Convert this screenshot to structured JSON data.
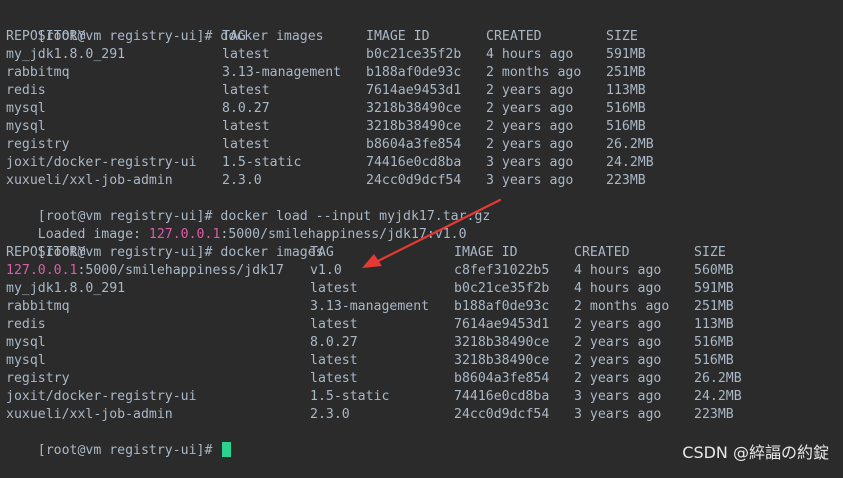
{
  "terminal": {
    "prompt": "[root@vm registry-ui]# ",
    "cmd1": "docker images",
    "cmd2": "docker load --input myjdk17.tar.gz",
    "loaded_prefix": "Loaded image: ",
    "loaded_ip": "127.0.0.1",
    "loaded_rest": ":5000/smilehappiness/jdk17:v1.0",
    "cmd3": "docker images"
  },
  "table1": {
    "headers": [
      "REPOSITORY",
      "TAG",
      "IMAGE ID",
      "CREATED",
      "SIZE"
    ],
    "rows": [
      [
        "my_jdk1.8.0_291",
        "latest",
        "b0c21ce35f2b",
        "4 hours ago",
        "591MB"
      ],
      [
        "rabbitmq",
        "3.13-management",
        "b188af0de93c",
        "2 months ago",
        "251MB"
      ],
      [
        "redis",
        "latest",
        "7614ae9453d1",
        "2 years ago",
        "113MB"
      ],
      [
        "mysql",
        "8.0.27",
        "3218b38490ce",
        "2 years ago",
        "516MB"
      ],
      [
        "mysql",
        "latest",
        "3218b38490ce",
        "2 years ago",
        "516MB"
      ],
      [
        "registry",
        "latest",
        "b8604a3fe854",
        "2 years ago",
        "26.2MB"
      ],
      [
        "joxit/docker-registry-ui",
        "1.5-static",
        "74416e0cd8ba",
        "3 years ago",
        "24.2MB"
      ],
      [
        "xuxueli/xxl-job-admin",
        "2.3.0",
        "24cc0d9dcf54",
        "3 years ago",
        "223MB"
      ]
    ]
  },
  "table2": {
    "headers": [
      "REPOSITORY",
      "TAG",
      "IMAGE ID",
      "CREATED",
      "SIZE"
    ],
    "first_row": {
      "repo_ip": "127.0.0.1",
      "repo_rest": ":5000/smilehappiness/jdk17",
      "tag": "v1.0",
      "id": "c8fef31022b5",
      "created": "4 hours ago",
      "size": "560MB"
    },
    "rows": [
      [
        "my_jdk1.8.0_291",
        "latest",
        "b0c21ce35f2b",
        "4 hours ago",
        "591MB"
      ],
      [
        "rabbitmq",
        "3.13-management",
        "b188af0de93c",
        "2 months ago",
        "251MB"
      ],
      [
        "redis",
        "latest",
        "7614ae9453d1",
        "2 years ago",
        "113MB"
      ],
      [
        "mysql",
        "8.0.27",
        "3218b38490ce",
        "2 years ago",
        "516MB"
      ],
      [
        "mysql",
        "latest",
        "3218b38490ce",
        "2 years ago",
        "516MB"
      ],
      [
        "registry",
        "latest",
        "b8604a3fe854",
        "2 years ago",
        "26.2MB"
      ],
      [
        "joxit/docker-registry-ui",
        "1.5-static",
        "74416e0cd8ba",
        "3 years ago",
        "24.2MB"
      ],
      [
        "xuxueli/xxl-job-admin",
        "2.3.0",
        "24cc0d9dcf54",
        "3 years ago",
        "223MB"
      ]
    ]
  },
  "watermark": "CSDN @綷諨の約錠",
  "colors": {
    "background": "#2b2b2b",
    "text": "#a9b7c6",
    "ip_highlight": "#d75fa6",
    "cursor": "#2bd48e",
    "arrow": "#e53935"
  }
}
